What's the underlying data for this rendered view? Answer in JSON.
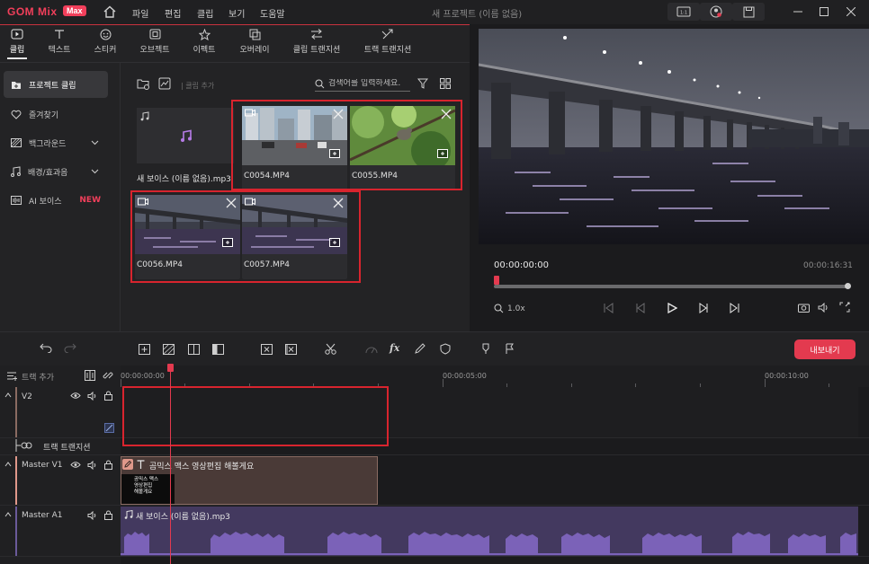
{
  "app": {
    "logo": "GOM Mix",
    "badge": "Max",
    "title": "새 프로젝트 (이름 없음)"
  },
  "menu": [
    "파일",
    "편집",
    "클립",
    "보기",
    "도움말"
  ],
  "tabs": [
    {
      "label": "클립",
      "icon": "clip-icon"
    },
    {
      "label": "텍스트",
      "icon": "text-icon"
    },
    {
      "label": "스티커",
      "icon": "sticker-icon"
    },
    {
      "label": "오브젝트",
      "icon": "object-icon"
    },
    {
      "label": "이펙트",
      "icon": "effect-icon"
    },
    {
      "label": "오버레이",
      "icon": "overlay-icon"
    },
    {
      "label": "클립 트랜지션",
      "icon": "clip-transition-icon"
    },
    {
      "label": "트랙 트랜지션",
      "icon": "track-transition-icon"
    }
  ],
  "sidebar": {
    "items": [
      {
        "label": "프로젝트 클립",
        "icon": "project-clip-icon"
      },
      {
        "label": "즐겨찾기",
        "icon": "heart-icon"
      },
      {
        "label": "백그라운드",
        "icon": "background-icon"
      },
      {
        "label": "배경/효과음",
        "icon": "music-icon"
      },
      {
        "label": "AI 보이스",
        "icon": "ai-voice-icon",
        "badge": "NEW"
      }
    ]
  },
  "content": {
    "clip_add_label": "| 클립 추가",
    "search_placeholder": "검색어를 입력하세요.",
    "clips": [
      {
        "name": "새 보이스 (이름 없음).mp3",
        "type": "audio"
      },
      {
        "name": "C0054.MP4",
        "type": "video"
      },
      {
        "name": "C0055.MP4",
        "type": "video"
      },
      {
        "name": "C0056.MP4",
        "type": "video"
      },
      {
        "name": "C0057.MP4",
        "type": "video"
      }
    ]
  },
  "preview": {
    "current_time": "00:00:00:00",
    "total_time": "00:00:16:31",
    "zoom": "1.0x"
  },
  "toolbar": {
    "export_label": "내보내기"
  },
  "timeline": {
    "add_track_label": "트랙 추가",
    "ruler": [
      "00:00:00:00",
      "00:00:05:00",
      "00:00:10:00"
    ],
    "tracks": {
      "v2": "V2",
      "track_transition": "트랙 트랜지션",
      "v1": "Master V1",
      "a1": "Master A1"
    },
    "v1_clip_text": "곰믹스 맥스 영상편집 해볼게요",
    "v1_thumb_text": "곰믹스 맥스\n영상편집\n해볼게요",
    "a1_clip_text": "새 보이스 (이름 없음).mp3"
  },
  "colors": {
    "accent": "#e33a4f",
    "highlight_box": "#d8242e",
    "audio_clip": "#43395f"
  }
}
